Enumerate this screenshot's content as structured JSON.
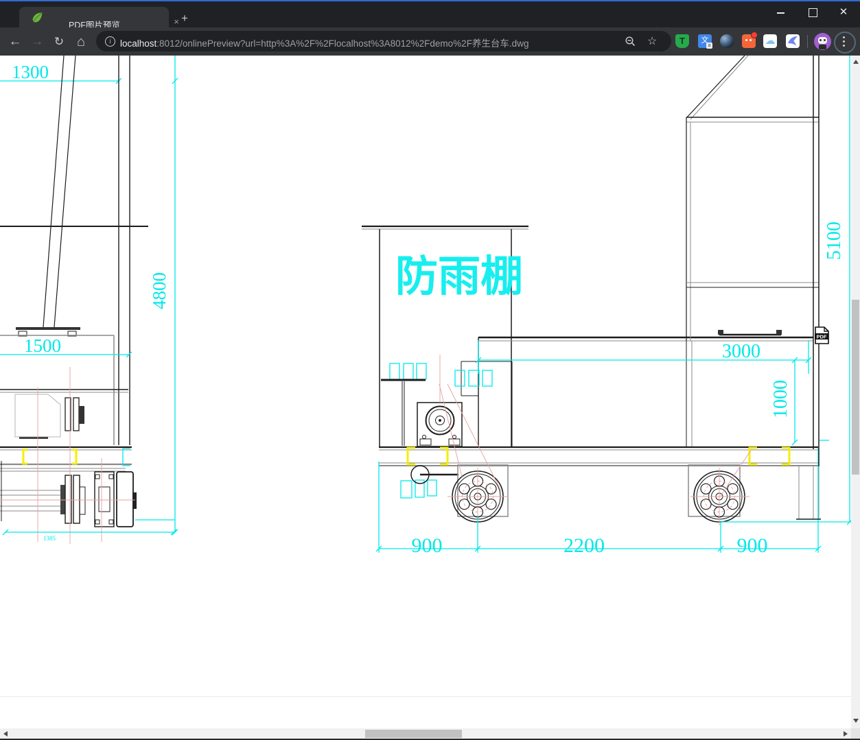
{
  "browser": {
    "tab": {
      "title": "PDF图片预览",
      "favicon": "spring-leaf-icon",
      "close_label": "×"
    },
    "new_tab_label": "+",
    "nav": {
      "back": "←",
      "forward": "→",
      "reload": "↻",
      "home": "⌂"
    },
    "address_bar": {
      "host": "localhost",
      "rest": ":8012/onlinePreview?url=http%3A%2F%2Flocalhost%3A8012%2Fdemo%2F养生台车.dwg"
    },
    "extensions": {
      "tampermonkey": "T",
      "translate": "文",
      "translate_corner": "a",
      "cloud": "☁"
    },
    "menu": "three-dots",
    "star": "☆"
  },
  "window_controls": {
    "minimize": "minimize",
    "maximize": "maximize",
    "close": "✕"
  },
  "drawing": {
    "shelter_label": "防雨棚",
    "pdf_badge": "PDF",
    "dimensions": {
      "d1300": "1300",
      "d4800": "4800",
      "d1500": "1500",
      "d1385": "1385",
      "d3000": "3000",
      "d1000": "1000",
      "d5100": "5100",
      "d900L": "900",
      "d2200": "2200",
      "d900R": "900"
    },
    "colors": {
      "dimension": "#00e9e9",
      "highlight_clip": "#f3ef00",
      "centerline": "#e6a0a0",
      "line": "#1c1c1c"
    }
  }
}
